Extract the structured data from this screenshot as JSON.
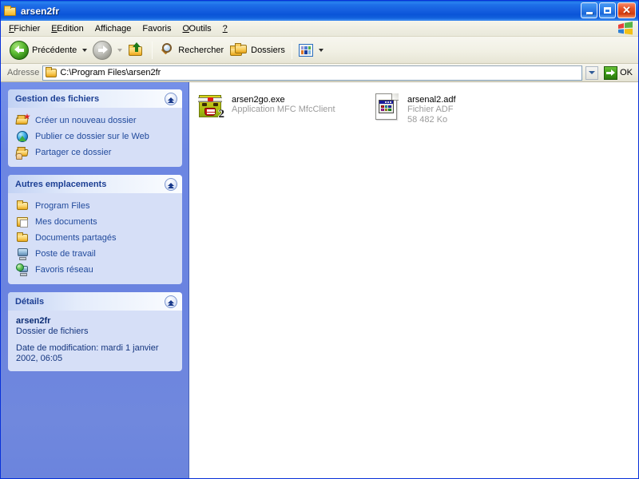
{
  "window": {
    "title": "arsen2fr",
    "title_icon": "folder-icon",
    "controls": {
      "minimize": "minimize-button",
      "maximize": "maximize-button",
      "close": "close-button",
      "close_glyph": "✕"
    }
  },
  "menubar": {
    "items": [
      {
        "label": "Fichier",
        "accel": "F"
      },
      {
        "label": "Edition",
        "accel": "E"
      },
      {
        "label": "Affichage",
        "accel": "h"
      },
      {
        "label": "Favoris",
        "accel": "v"
      },
      {
        "label": "Outils",
        "accel": "O"
      },
      {
        "label": "?",
        "accel": "?"
      }
    ],
    "brand_icon": "windows-flag-icon"
  },
  "toolbar": {
    "back_label": "Précédente",
    "forward_label": "",
    "up_label": "",
    "search_label": "Rechercher",
    "folders_label": "Dossiers",
    "views_label": "",
    "icons": {
      "back": "back-arrow-icon",
      "forward": "forward-arrow-icon",
      "up": "up-folder-icon",
      "search": "magnifier-icon",
      "folders": "folders-icon",
      "views": "views-icon"
    },
    "views_cell_colors": [
      "#9a9ad6",
      "#4f7fd6",
      "#4fb04f",
      "#e07a2a",
      "#1b3f9c",
      "#7fb8e0"
    ]
  },
  "address": {
    "label": "Adresse",
    "path": "C:\\Program Files\\arsen2fr",
    "placeholder": "",
    "go_label": "OK",
    "folder_icon": "folder-icon",
    "dropdown_icon": "chevron-down-icon",
    "go_icon": "go-arrow-icon"
  },
  "sidebar": {
    "panels": [
      {
        "title": "Gestion des fichiers",
        "collapse_icon": "chevron-up-icon",
        "links": [
          {
            "label": "Créer un nouveau dossier",
            "icon": "new-folder-icon"
          },
          {
            "label": "Publier ce dossier sur le Web",
            "icon": "web-publish-icon"
          },
          {
            "label": "Partager ce dossier",
            "icon": "share-folder-icon"
          }
        ]
      },
      {
        "title": "Autres emplacements",
        "collapse_icon": "chevron-up-icon",
        "links": [
          {
            "label": "Program Files",
            "icon": "folder-icon"
          },
          {
            "label": "Mes documents",
            "icon": "my-documents-icon"
          },
          {
            "label": "Documents partagés",
            "icon": "folder-icon"
          },
          {
            "label": "Poste de travail",
            "icon": "my-computer-icon"
          },
          {
            "label": "Favoris réseau",
            "icon": "network-icon"
          }
        ]
      }
    ],
    "details": {
      "title": "Détails",
      "collapse_icon": "chevron-up-icon",
      "name": "arsen2fr",
      "type": "Dossier de fichiers",
      "date": "Date de modification: mardi 1 janvier 2002, 06:05"
    }
  },
  "files": [
    {
      "name": "arsen2go.exe",
      "type": "Application MFC MfcClient",
      "size": "",
      "icon": "arsen2go-app-icon"
    },
    {
      "name": "arsenal2.adf",
      "type": "Fichier ADF",
      "size": "58 482 Ko",
      "icon": "adf-document-icon"
    }
  ],
  "colors": {
    "title_blue": "#0054e3",
    "sidebar_blue": "#6c86e2",
    "panel_body": "#d6dff7",
    "panel_title_text": "#1c3f94",
    "link_text": "#214a9c",
    "close_red": "#e8552a",
    "go_green": "#3d9c16",
    "file_sub_gray": "#9b9b9b"
  },
  "adf_icon_cells": [
    "#e02020",
    "#20c8d8",
    "#2030d8",
    "#d820c8",
    "#e0d020",
    "#20c020"
  ]
}
